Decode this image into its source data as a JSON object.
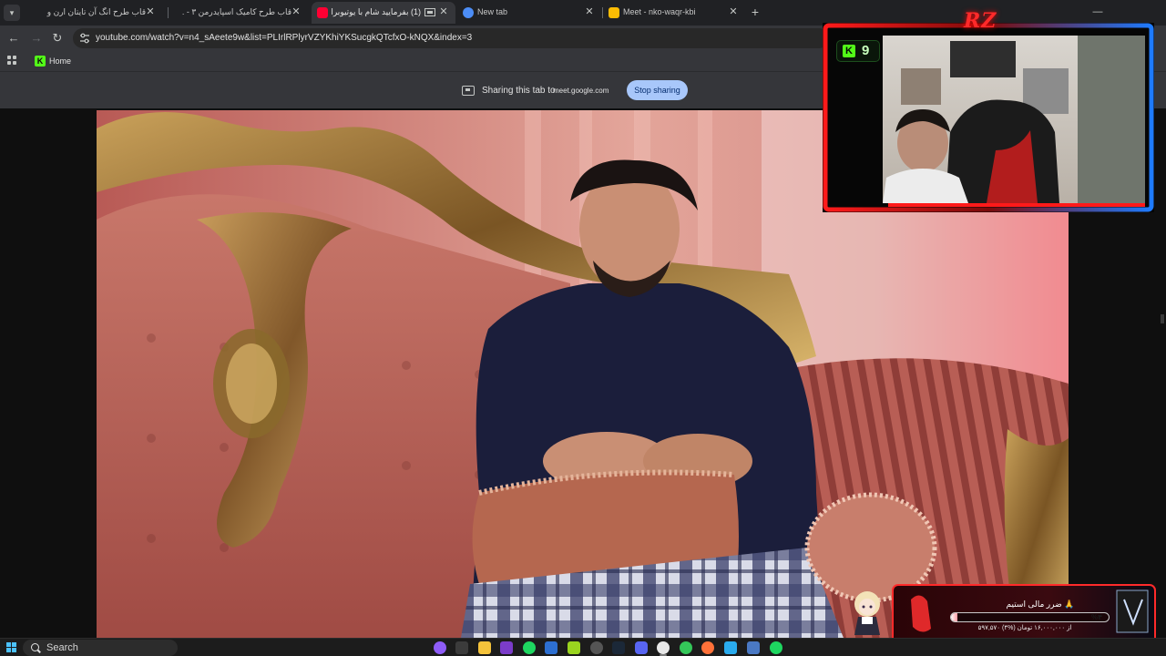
{
  "browser": {
    "tabs": [
      {
        "title": "قاب طرح انگ آن تایتان ارن و میکا",
        "active": false
      },
      {
        "title": "قاب طرح کامیک اسپایدرمن ۳ - ...",
        "active": false
      },
      {
        "title": "(1) بفرمایید شام با یوتیوبرا (...",
        "active": true
      },
      {
        "title": "New tab",
        "active": false
      },
      {
        "title": "Meet - nko-waqr-kbi",
        "active": false
      }
    ],
    "url": "youtube.com/watch?v=n4_sAeete9w&list=PLIrlRPlyrVZYKhiYKSucgkQTcfxO-kNQX&index=3",
    "bookmarks": [
      {
        "label": "Home",
        "icon": "kick-icon"
      }
    ]
  },
  "sharing_bar": {
    "message": "Sharing this tab to",
    "domain": "meet.google.com",
    "stop_button": "Stop sharing"
  },
  "stream_overlay": {
    "kick_label": "K",
    "viewer_count": "9",
    "logo_text": "RZ"
  },
  "goal_widget": {
    "title": "ضرر مالی استیم 🙏",
    "percent_label": "%۴",
    "progress": 0.04,
    "subtitle": "۵۹۷,۵۷۰ از ۱۶,۰۰۰,۰۰۰ تومان (%۴)"
  },
  "taskbar": {
    "search_label": "Search"
  },
  "colors": {
    "accent_blue": "#a8c7fa",
    "kick_green": "#53fc18",
    "overlay_red": "#ff2a2a",
    "overlay_blue": "#1e7bff"
  }
}
